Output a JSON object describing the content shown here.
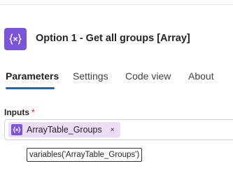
{
  "action": {
    "title": "Option 1 - Get all groups [Array]",
    "icon": "variable-icon",
    "icon_color": "#7b55d9"
  },
  "tabs": [
    {
      "label": "Parameters",
      "active": true
    },
    {
      "label": "Settings",
      "active": false
    },
    {
      "label": "Code view",
      "active": false
    },
    {
      "label": "About",
      "active": false
    }
  ],
  "inputs": {
    "label": "Inputs",
    "required_marker": "*",
    "token": {
      "label": "ArrayTable_Groups",
      "icon": "variable-icon",
      "close_glyph": "×",
      "background": "#ecdcf6"
    },
    "tooltip": "variables('ArrayTable_Groups')"
  },
  "accent_color": "#0f6cbd"
}
